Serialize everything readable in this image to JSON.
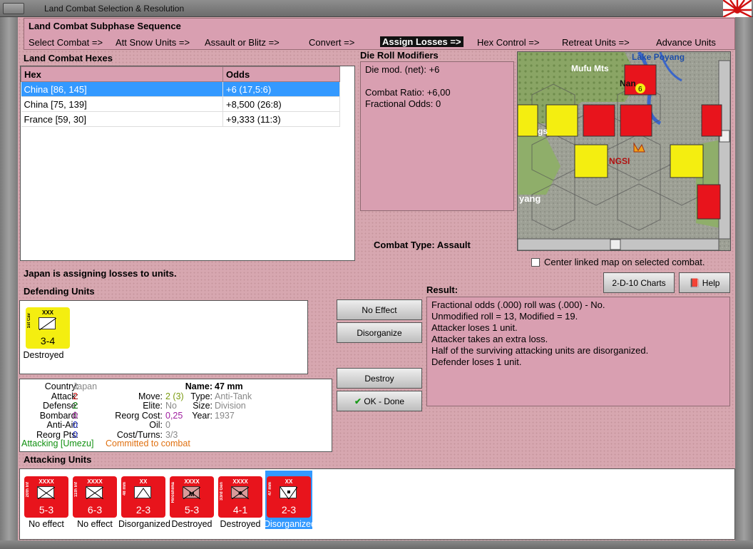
{
  "window": {
    "title": "Land Combat Selection & Resolution"
  },
  "phase": {
    "title": "Land Combat Subphase Sequence",
    "steps": [
      "Select Combat =>",
      "Att Snow Units =>",
      "Assault or Blitz =>",
      "Convert =>",
      "Assign Losses =>",
      "Hex Control =>",
      "Retreat Units =>",
      "Advance Units"
    ],
    "active_index": 4
  },
  "hexes": {
    "label": "Land Combat Hexes",
    "columns": [
      "Hex",
      "Odds"
    ],
    "rows": [
      [
        "China [86, 145]",
        "+6 (17,5:6)"
      ],
      [
        "China [75, 139]",
        "+8,500 (26:8)"
      ],
      [
        "France [59, 30]",
        "+9,333 (11:3)"
      ]
    ],
    "selected": 0
  },
  "modifiers": {
    "label": "Die Roll Modifiers",
    "lines": [
      "Die mod. (net): +6",
      "",
      "Combat Ratio: +6,00",
      "Fractional Odds: 0"
    ]
  },
  "combat_type": {
    "label": "Combat Type:",
    "value": "Assault"
  },
  "map": {
    "labels": [
      "Lake Poyang",
      "Mufu Mts",
      "Nan",
      "NGSI",
      "yang",
      "gs"
    ],
    "center_linked_label": "Center linked map on selected combat."
  },
  "status": {
    "message": "Japan is assigning losses to units."
  },
  "buttons": {
    "charts": "2-D-10 Charts",
    "help": "Help",
    "no_effect": "No Effect",
    "disorganize": "Disorganize",
    "destroy": "Destroy",
    "ok_done": "OK - Done"
  },
  "defending": {
    "label": "Defending Units",
    "units": [
      {
        "size": "XXX",
        "name": "1st Cav",
        "stats": "3-4",
        "caption": "Destroyed",
        "color": "#f4ee10"
      }
    ]
  },
  "result": {
    "label": "Result:",
    "lines": [
      "Fractional odds (.000) roll was (.000)  - No.",
      "Unmodified roll = 13, Modified = 19.",
      "Attacker loses 1 unit.",
      "Attacker takes an extra loss.",
      "Half of the surviving attacking units are disorganized.",
      "Defender loses 1 unit."
    ]
  },
  "info": {
    "country_k": "Country:",
    "country_v": "Japan",
    "attack_k": "Attack:",
    "attack_v": "2",
    "defense_k": "Defense:",
    "defense_v": "2",
    "bombard_k": "Bombard:",
    "bombard_v": "0",
    "antiair_k": "Anti-Air:",
    "antiair_v": "0",
    "reorg_k": "Reorg Pts:",
    "reorg_v": "0",
    "name_k": "Name:",
    "name_v": "47 mm",
    "move_k": "Move:",
    "move_v": "2 (3)",
    "type_k": "Type:",
    "type_v": "Anti-Tank",
    "elite_k": "Elite:",
    "elite_v": "No",
    "size_k": "Size:",
    "size_v": "Division",
    "rcost_k": "Reorg Cost:",
    "rcost_v": "0,25",
    "year_k": "Year:",
    "year_v": "1937",
    "oil_k": "Oil:",
    "oil_v": "0",
    "cost_k": "Cost/Turns:",
    "cost_v": "3/3",
    "attacking": "Attacking [Umezu]",
    "committed": "Committed to combat"
  },
  "attacking": {
    "label": "Attacking Units",
    "units": [
      {
        "size": "XXXX",
        "name": "20th Inf",
        "stats": "5-3",
        "caption": "No effect"
      },
      {
        "size": "XXXX",
        "name": "11th Inf",
        "stats": "6-3",
        "caption": "No effect"
      },
      {
        "size": "XX",
        "name": "48 mm",
        "stats": "2-3",
        "caption": "Disorganized"
      },
      {
        "size": "XXXX",
        "name": "Hiroshima",
        "stats": "5-3",
        "caption": "Destroyed"
      },
      {
        "size": "XXXX",
        "name": "33rd Gen",
        "stats": "4-1",
        "caption": "Destroyed"
      },
      {
        "size": "XX",
        "name": "47 mm",
        "stats": "2-3",
        "caption": "Disorganized"
      }
    ],
    "selected": 5
  },
  "colors": {
    "panel_pink": "#d99fb1",
    "unit_red": "#e8141c",
    "unit_yellow": "#f4ee10",
    "selection_blue": "#3399ff"
  }
}
